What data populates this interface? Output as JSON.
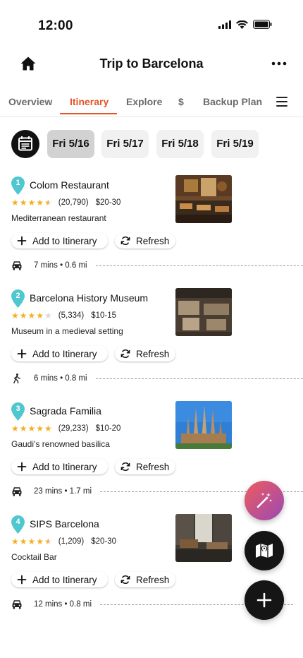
{
  "status_bar": {
    "time": "12:00"
  },
  "header": {
    "title": "Trip to Barcelona",
    "home_icon": "home-icon",
    "more_icon": "more-icon"
  },
  "tabs": [
    {
      "label": "Overview",
      "active": false
    },
    {
      "label": "Itinerary",
      "active": true
    },
    {
      "label": "Explore",
      "active": false
    },
    {
      "label": "$",
      "active": false
    },
    {
      "label": "Backup Plan",
      "active": false
    }
  ],
  "dates": [
    {
      "label": "Fri 5/16",
      "selected": true
    },
    {
      "label": "Fri 5/17",
      "selected": false
    },
    {
      "label": "Fri 5/18",
      "selected": false
    },
    {
      "label": "Fri 5/19",
      "selected": false
    }
  ],
  "actions": {
    "add_label": "Add to Itinerary",
    "refresh_label": "Refresh"
  },
  "places": [
    {
      "num": "1",
      "name": "Colom Restaurant",
      "stars": 4.5,
      "reviews": "(20,790)",
      "price": "$20-30",
      "desc": "Mediterranean restaurant",
      "travel_mode": "car",
      "travel": "7 mins • 0.6 mi"
    },
    {
      "num": "2",
      "name": "Barcelona History Museum",
      "stars": 4,
      "reviews": "(5,334)",
      "price": "$10-15",
      "desc": "Museum in a medieval setting",
      "travel_mode": "walk",
      "travel": "6 mins • 0.8 mi"
    },
    {
      "num": "3",
      "name": "Sagrada Familia",
      "stars": 5,
      "reviews": "(29,233)",
      "price": "$10-20",
      "desc": "Gaudi’s renowned basilica",
      "travel_mode": "car",
      "travel": "23 mins • 1.7 mi"
    },
    {
      "num": "4",
      "name": "SIPS Barcelona",
      "stars": 4.5,
      "reviews": "(1,209)",
      "price": "$20-30",
      "desc": "Cocktail Bar",
      "travel_mode": "car",
      "travel": "12 mins • 0.8 mi"
    }
  ],
  "colors": {
    "accent": "#e2552b",
    "pin": "#4ec7cf",
    "star": "#f2b01e"
  }
}
